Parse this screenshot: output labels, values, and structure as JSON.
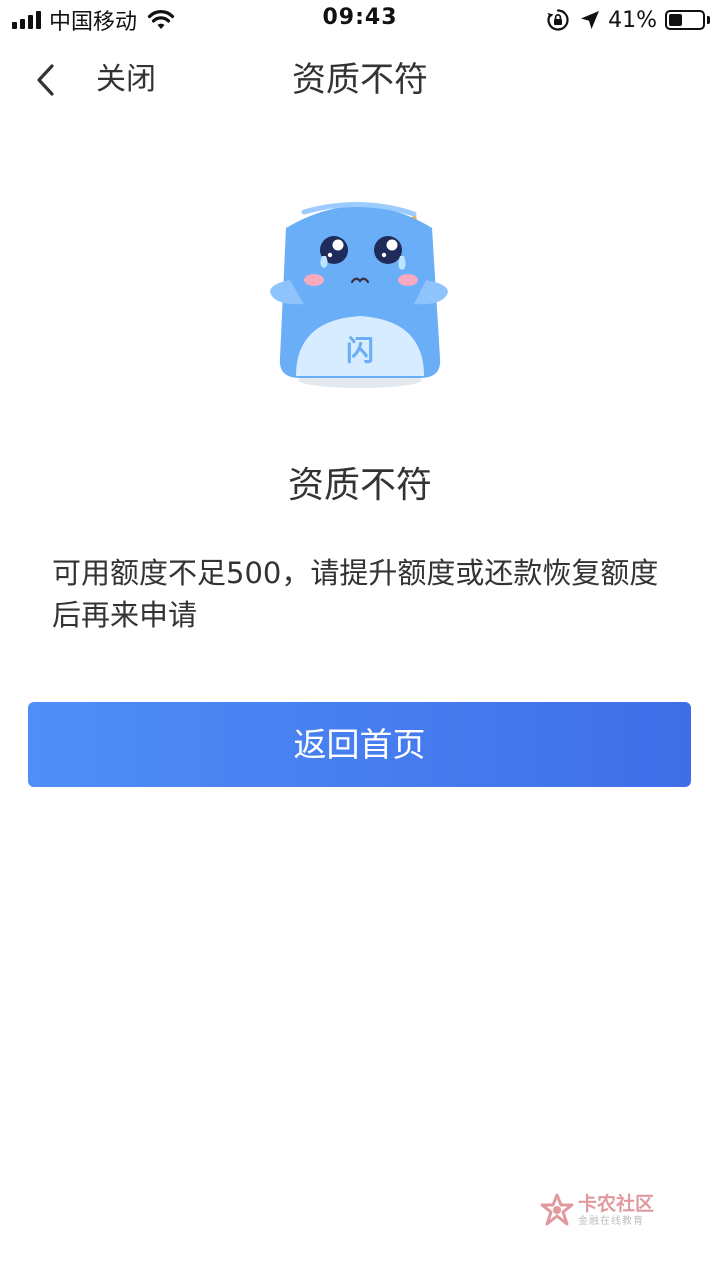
{
  "status_bar": {
    "carrier": "中国移动",
    "time": "09:43",
    "battery_percent": "41%",
    "battery_level": 0.41,
    "icons": [
      "signal-icon",
      "wifi-icon",
      "rotation-lock-icon",
      "location-arrow-icon",
      "battery-icon"
    ]
  },
  "nav": {
    "back_icon": "chevron-left-icon",
    "close_label": "关闭",
    "title": "资质不符"
  },
  "illustration": {
    "icon": "crying-mascot-icon",
    "badge_text": "闪"
  },
  "result": {
    "title": "资质不符",
    "message": "可用额度不足500，请提升额度或还款恢复额度后再来申请"
  },
  "actions": {
    "home_button_label": "返回首页"
  },
  "watermark": {
    "icon": "kanong-logo-icon",
    "name": "卡农社区",
    "tagline": "金融在线教育"
  },
  "colors": {
    "button_gradient_start": "#4f8ef7",
    "button_gradient_end": "#3f6ee8",
    "mascot_body": "#6aaef8",
    "text_primary": "#333333"
  }
}
